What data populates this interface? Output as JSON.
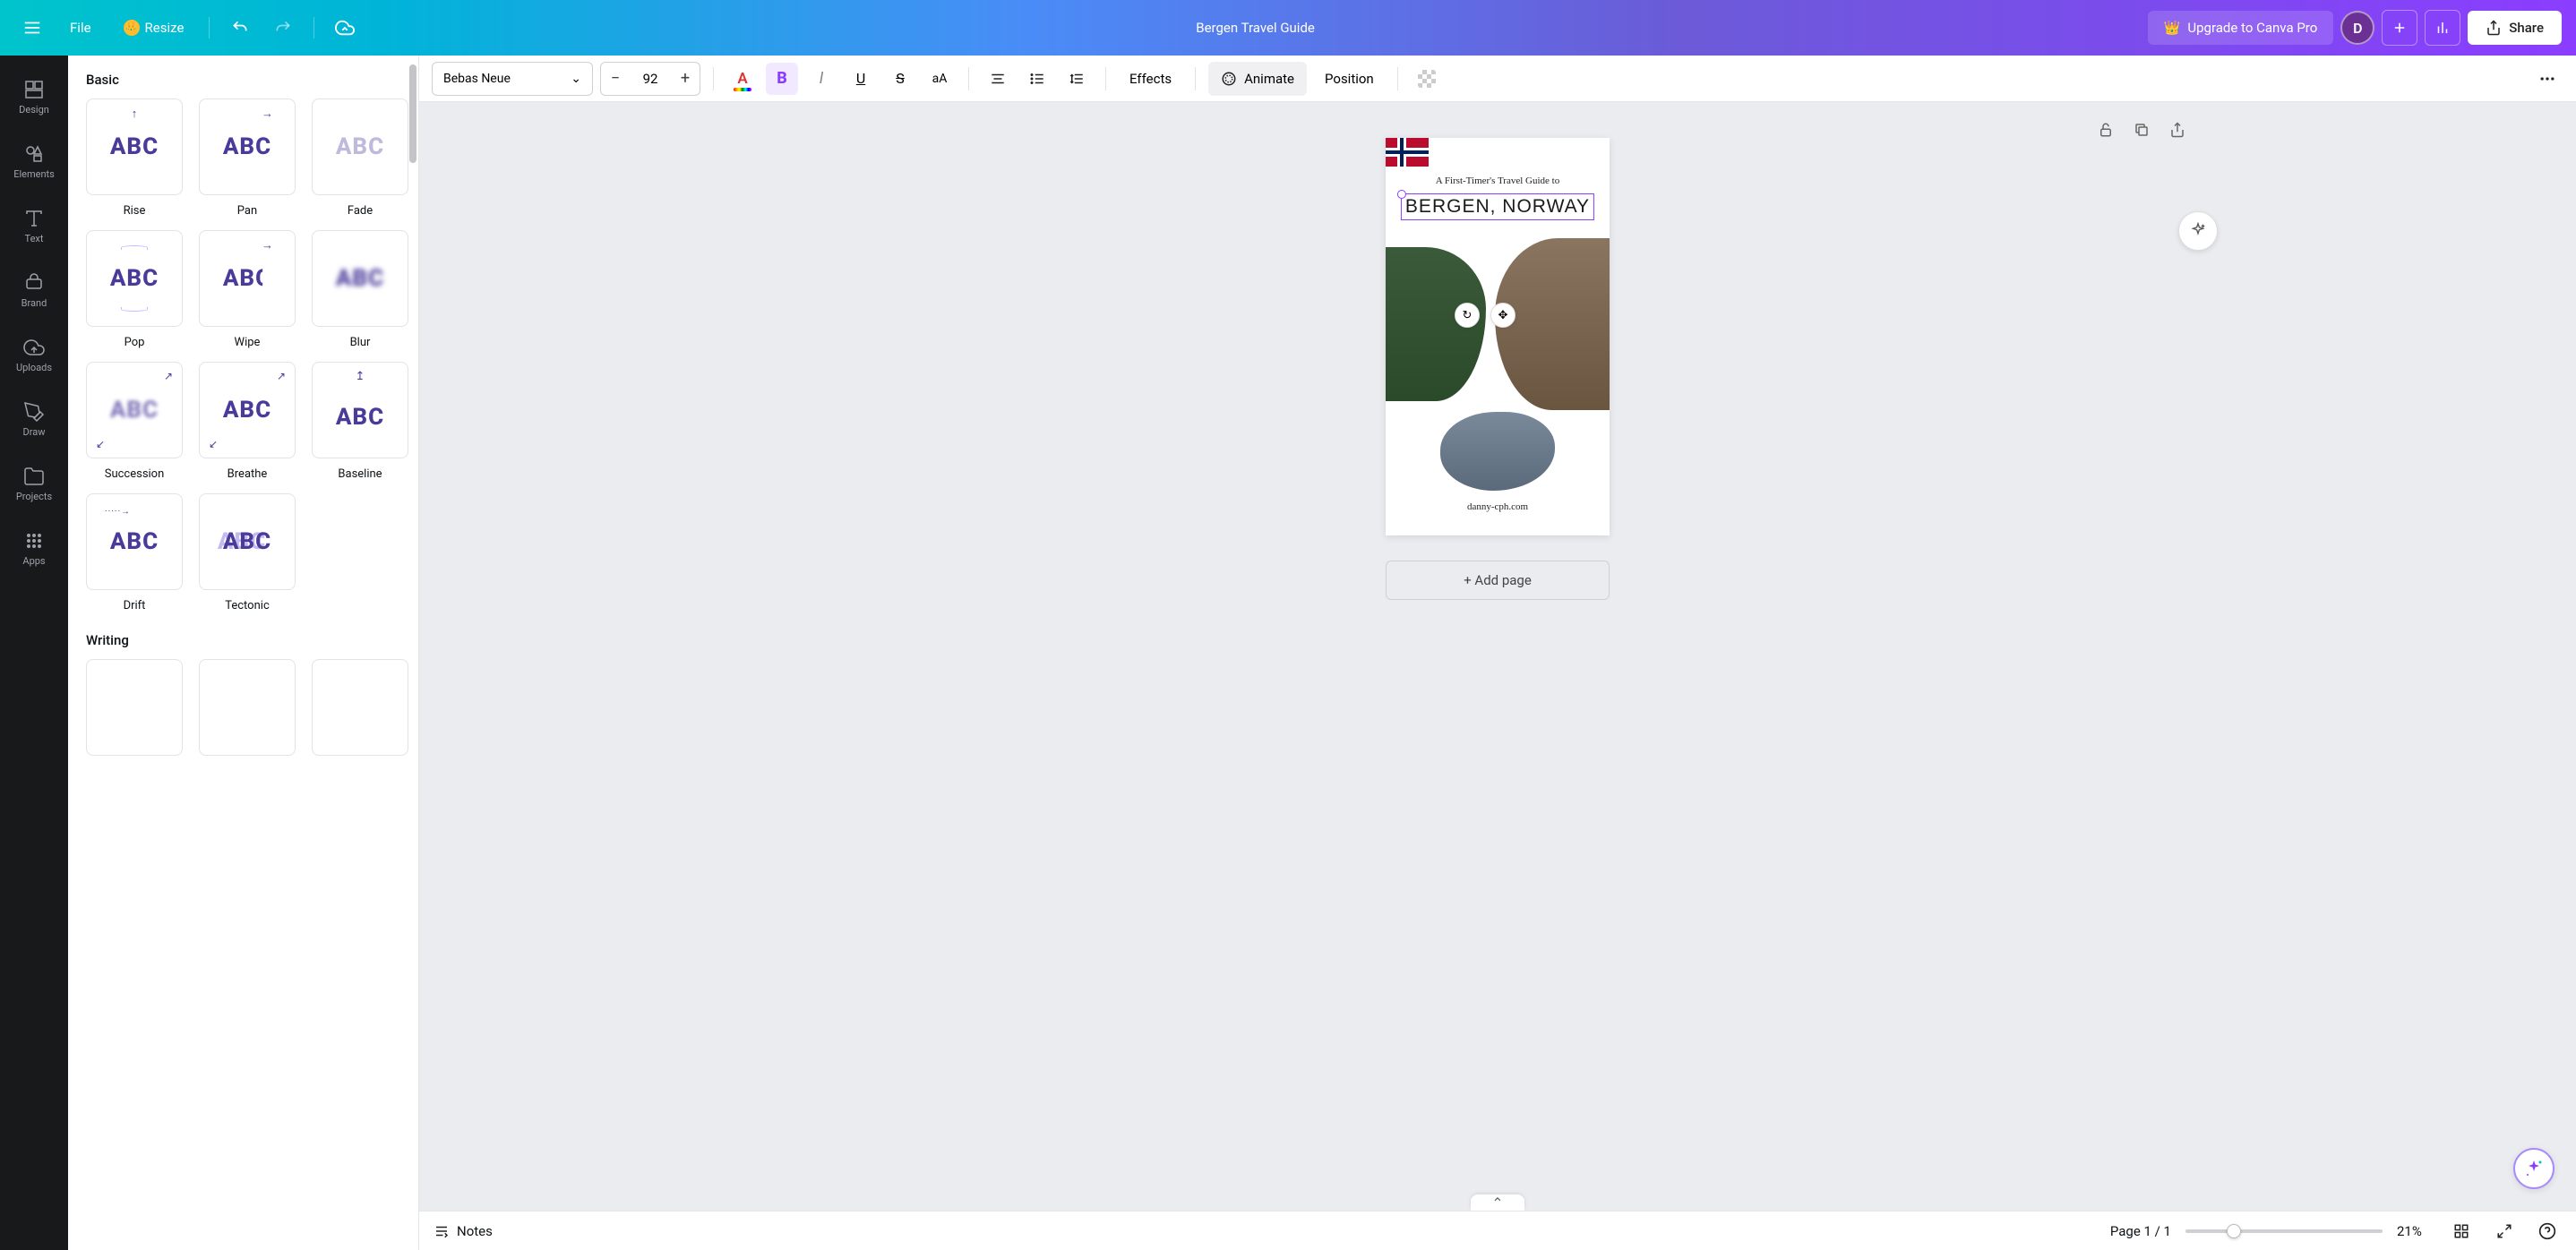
{
  "header": {
    "file_label": "File",
    "resize_label": "Resize",
    "doc_title": "Bergen Travel Guide",
    "upgrade_label": "Upgrade to Canva Pro",
    "avatar_letter": "D",
    "share_label": "Share"
  },
  "nav_rail": [
    {
      "id": "design",
      "label": "Design"
    },
    {
      "id": "elements",
      "label": "Elements"
    },
    {
      "id": "text",
      "label": "Text"
    },
    {
      "id": "brand",
      "label": "Brand"
    },
    {
      "id": "uploads",
      "label": "Uploads"
    },
    {
      "id": "draw",
      "label": "Draw"
    },
    {
      "id": "projects",
      "label": "Projects"
    },
    {
      "id": "apps",
      "label": "Apps"
    }
  ],
  "panel": {
    "section_basic": "Basic",
    "section_writing": "Writing",
    "animations": [
      {
        "id": "rise",
        "label": "Rise"
      },
      {
        "id": "pan",
        "label": "Pan"
      },
      {
        "id": "fade",
        "label": "Fade"
      },
      {
        "id": "pop",
        "label": "Pop"
      },
      {
        "id": "wipe",
        "label": "Wipe"
      },
      {
        "id": "blur",
        "label": "Blur"
      },
      {
        "id": "succession",
        "label": "Succession"
      },
      {
        "id": "breathe",
        "label": "Breathe"
      },
      {
        "id": "baseline",
        "label": "Baseline"
      },
      {
        "id": "drift",
        "label": "Drift"
      },
      {
        "id": "tectonic",
        "label": "Tectonic"
      }
    ],
    "abc": "ABC"
  },
  "toolbar": {
    "font_name": "Bebas Neue",
    "font_size": "92",
    "effects_label": "Effects",
    "animate_label": "Animate",
    "position_label": "Position"
  },
  "canvas": {
    "subtitle": "A First-Timer's Travel Guide to",
    "title": "BERGEN, NORWAY",
    "website": "danny-cph.com",
    "add_page_label": "+ Add page"
  },
  "bottom": {
    "notes_label": "Notes",
    "page_counter": "Page 1 / 1",
    "zoom_pct": "21%"
  }
}
